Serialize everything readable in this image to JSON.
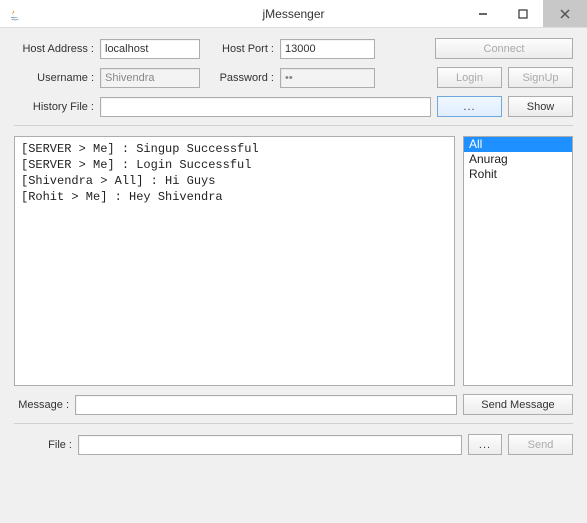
{
  "window": {
    "title": "jMessenger"
  },
  "connection": {
    "host_label": "Host Address :",
    "host_value": "localhost",
    "port_label": "Host Port :",
    "port_value": "13000",
    "connect_label": "Connect"
  },
  "auth": {
    "user_label": "Username :",
    "user_value": "Shivendra",
    "pass_label": "Password :",
    "pass_value": "••",
    "login_label": "Login",
    "signup_label": "SignUp"
  },
  "history": {
    "label": "History File :",
    "path_value": "",
    "browse_label": "...",
    "show_label": "Show"
  },
  "chat": {
    "lines": [
      "[SERVER > Me] : Singup Successful",
      "[SERVER > Me] : Login Successful",
      "[Shivendra > All] : Hi Guys",
      "[Rohit > Me] : Hey Shivendra"
    ]
  },
  "users": {
    "items": [
      "All",
      "Anurag",
      "Rohit"
    ],
    "selected_index": 0
  },
  "message": {
    "label": "Message :",
    "value": "",
    "send_label": "Send Message"
  },
  "file": {
    "label": "File :",
    "value": "",
    "browse_label": "...",
    "send_label": "Send"
  }
}
